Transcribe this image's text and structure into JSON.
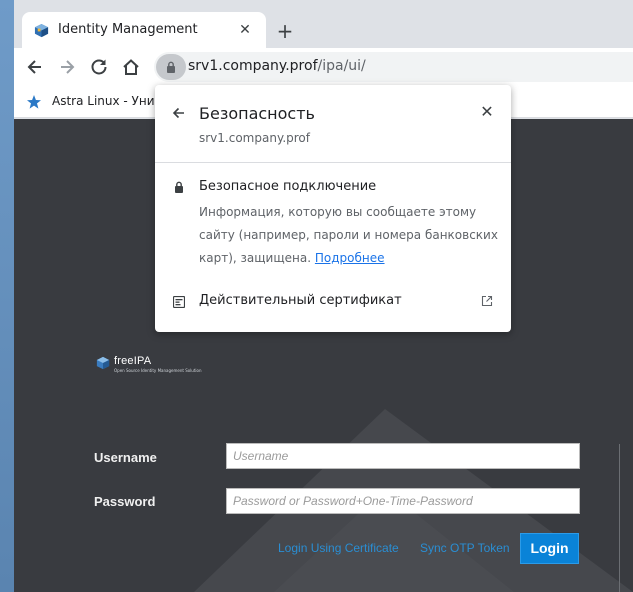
{
  "browser": {
    "tab": {
      "title": "Identity Management",
      "close_icon": "close-icon"
    },
    "new_tab_icon": "plus-icon",
    "toolbar": {
      "back_icon": "arrow-back-icon",
      "forward_icon": "arrow-forward-icon",
      "reload_icon": "reload-icon",
      "home_icon": "home-icon",
      "lock_icon": "lock-icon"
    },
    "url": {
      "host": "srv1.company.prof",
      "path": "/ipa/ui/"
    },
    "bookmarks": [
      {
        "label": "Astra Linux - Уни",
        "icon": "star-icon"
      }
    ]
  },
  "security_popup": {
    "title": "Безопасность",
    "host": "srv1.company.prof",
    "connection_title": "Безопасное подключение",
    "connection_desc": "Информация, которую вы сообщаете этому сайту (например, пароли и номера банковских карт), защищена.",
    "more_link": "Подробнее",
    "certificate_label": "Действительный сертификат"
  },
  "login_page": {
    "logo_text": "freeIPA",
    "logo_subtext": "Open Source Identity Management Solution",
    "username_label": "Username",
    "username_placeholder": "Username",
    "password_label": "Password",
    "password_placeholder": "Password or Password+One-Time-Password",
    "cert_link": "Login Using Certificate",
    "otp_link": "Sync OTP Token",
    "login_button": "Login"
  },
  "colors": {
    "page_bg": "#393b40",
    "accent": "#0a83d8",
    "link": "#2a8ed3",
    "popup_link": "#1a73e8"
  }
}
